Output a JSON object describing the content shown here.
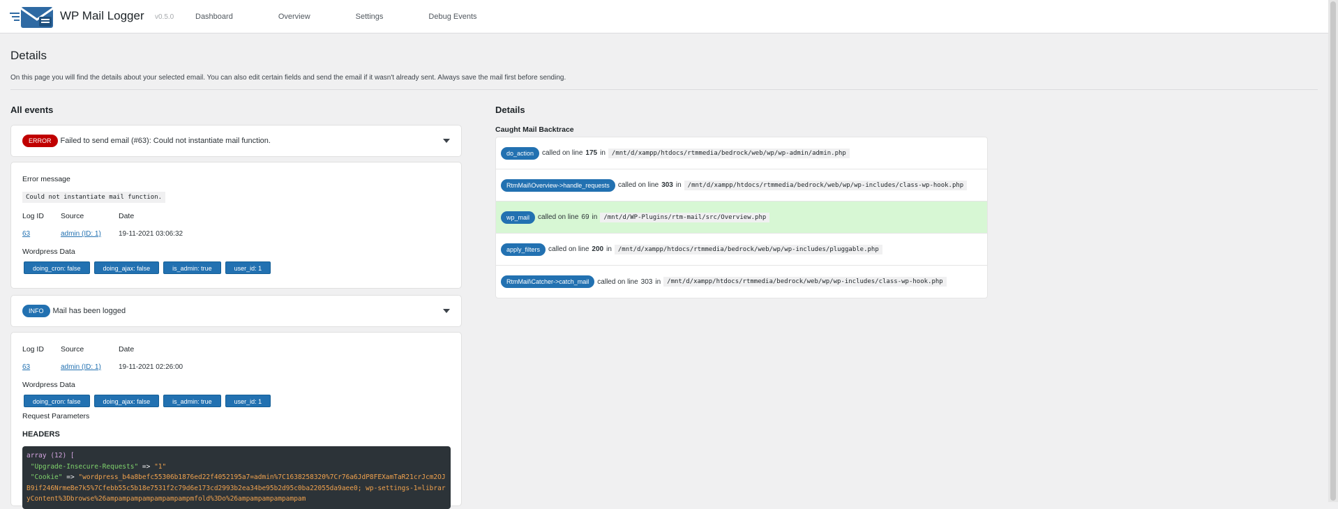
{
  "app": {
    "title": "WP Mail Logger",
    "version": "v0.5.0",
    "nav": [
      "Dashboard",
      "Overview",
      "Settings",
      "Debug Events"
    ]
  },
  "page": {
    "title": "Details",
    "intro": "On this page you will find the details about your selected email. You can also edit certain fields and send the email if it wasn't already sent. Always save the mail first before sending."
  },
  "events": {
    "title": "All events",
    "error": {
      "badge": "ERROR",
      "text": "Failed to send email (#63): Could not instantiate mail function.",
      "error_label": "Error message",
      "error_value": "Could not instantiate mail function.",
      "log_id_label": "Log ID",
      "source_label": "Source",
      "date_label": "Date",
      "log_id": "63",
      "source": "admin (ID: 1)",
      "date": "19-11-2021 03:06:32",
      "wp_label": "Wordpress Data",
      "chips": [
        "doing_cron: false",
        "doing_ajax: false",
        "is_admin: true",
        "user_id: 1"
      ]
    },
    "info": {
      "badge": "INFO",
      "text": "Mail has been logged",
      "log_id_label": "Log ID",
      "source_label": "Source",
      "date_label": "Date",
      "log_id": "63",
      "source": "admin (ID: 1)",
      "date": "19-11-2021 02:26:00",
      "wp_label": "Wordpress Data",
      "chips": [
        "doing_cron: false",
        "doing_ajax: false",
        "is_admin: true",
        "user_id: 1"
      ],
      "request_label": "Request Parameters",
      "headers_label": "HEADERS",
      "code": {
        "line1": "array (12) [",
        "key1": "\"Upgrade-Insecure-Requests\"",
        "val1": "\"1\"",
        "key2": "\"Cookie\"",
        "arrow": " => ",
        "val2": "\"wordpress_b4a8befc55306b1876ed22f4052195a7=admin%7C1638258320%7Cr76a6JdP8FEXamTaR21crJcm2OJB9if246NrmeBe7k5%7Cfebb55c5b18e7531f2c79d6e173cd2993b2ea34be95b2d95c0ba22055da9aee0; wp-settings-1=libraryContent%3Dbrowse%26ampampampampampampampmfold%3Do%26ampampampampampam"
      }
    }
  },
  "details": {
    "title": "Details",
    "backtrace_title": "Caught Mail Backtrace",
    "called_on": "called on line",
    "in_word": "in",
    "rows": [
      {
        "fn": "do_action",
        "line": "175",
        "path": "/mnt/d/xampp/htdocs/rtmmedia/bedrock/web/wp/wp-admin/admin.php"
      },
      {
        "fn": "RtmMail\\Overview->handle_requests",
        "line": "303",
        "path": "/mnt/d/xampp/htdocs/rtmmedia/bedrock/web/wp/wp-includes/class-wp-hook.php"
      },
      {
        "fn": "wp_mail",
        "line": "69",
        "path": "/mnt/d/WP-Plugins/rtm-mail/src/Overview.php"
      },
      {
        "fn": "apply_filters",
        "line": "200",
        "path": "/mnt/d/xampp/htdocs/rtmmedia/bedrock/web/wp/wp-includes/pluggable.php"
      },
      {
        "fn": "RtmMail\\Catcher->catch_mail",
        "line": "303",
        "path": "/mnt/d/xampp/htdocs/rtmmedia/bedrock/web/wp/wp-includes/class-wp-hook.php"
      }
    ]
  },
  "colors": {
    "accent": "#2271b1",
    "error": "#c00000",
    "highlight": "#d7f7d4"
  },
  "icons": {
    "logo": "mail-envelope-icon",
    "expand": "chevron-down-icon"
  }
}
